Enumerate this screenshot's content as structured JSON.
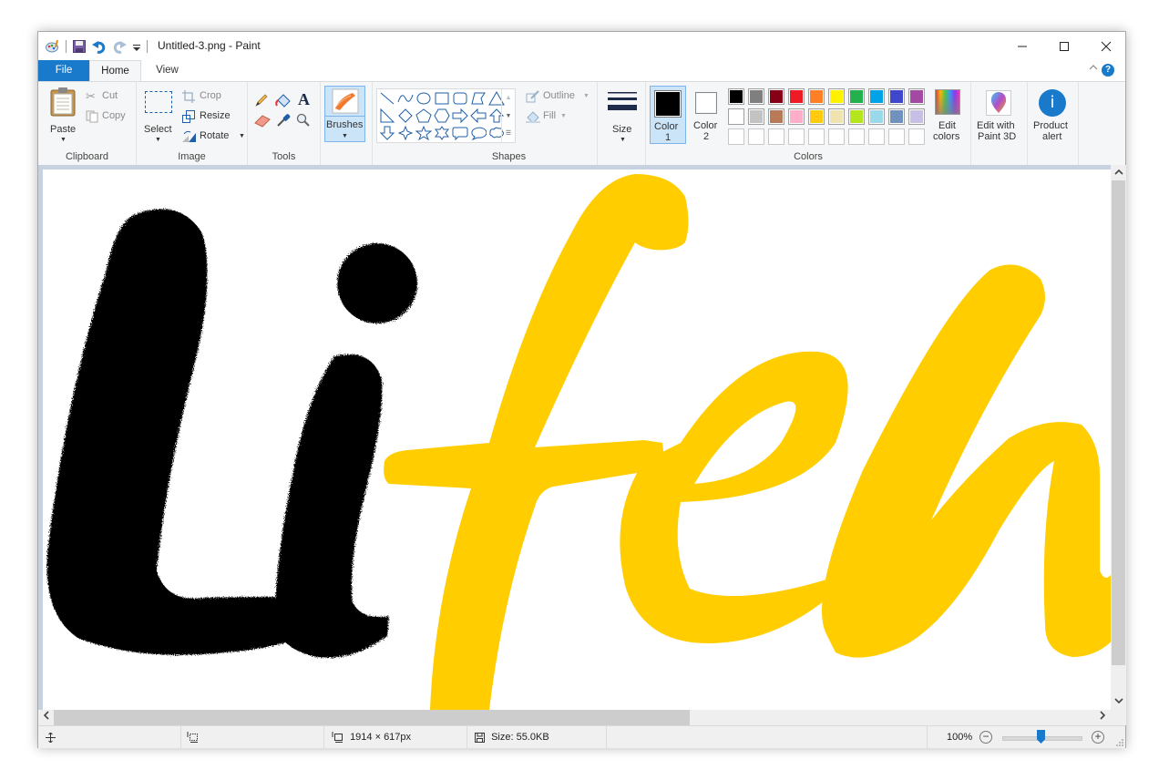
{
  "window": {
    "title": "Untitled-3.png - Paint",
    "controls": {
      "minimize": "—",
      "maximize": "☐",
      "close": "✕"
    }
  },
  "quick_access": {
    "icons": [
      "paint-app-icon",
      "save-icon",
      "undo-icon",
      "redo-icon",
      "customize-qat-icon"
    ]
  },
  "tabs": [
    {
      "label": "File",
      "active": false
    },
    {
      "label": "Home",
      "active": true
    },
    {
      "label": "View",
      "active": false
    }
  ],
  "ribbon": {
    "clipboard": {
      "group_label": "Clipboard",
      "paste": "Paste",
      "cut": "Cut",
      "copy": "Copy"
    },
    "image": {
      "group_label": "Image",
      "select": "Select",
      "crop": "Crop",
      "resize": "Resize",
      "rotate": "Rotate"
    },
    "tools": {
      "group_label": "Tools",
      "items": [
        "pencil",
        "fill",
        "text",
        "eraser",
        "color-picker",
        "magnifier"
      ]
    },
    "brushes": {
      "label": "Brushes"
    },
    "shapes": {
      "group_label": "Shapes",
      "outline": "Outline",
      "fill": "Fill",
      "items": [
        "line",
        "curve",
        "oval",
        "rectangle",
        "rounded-rectangle",
        "polygon",
        "triangle",
        "right-triangle",
        "diamond",
        "pentagon",
        "hexagon",
        "right-arrow",
        "left-arrow",
        "up-arrow",
        "down-arrow",
        "four-point-star",
        "five-point-star",
        "six-point-star",
        "rounded-callout",
        "oval-callout",
        "cloud-callout"
      ]
    },
    "size": {
      "label": "Size"
    },
    "colors": {
      "group_label": "Colors",
      "color1_label": "Color",
      "color1_num": "1",
      "color2_label": "Color",
      "color2_num": "2",
      "color1": "#000000",
      "color2": "#ffffff",
      "palette_row1": [
        "#000000",
        "#7f7f7f",
        "#880015",
        "#ed1c24",
        "#ff7f27",
        "#fff200",
        "#22b14c",
        "#00a2e8",
        "#3f48cc",
        "#a349a4"
      ],
      "palette_row2": [
        "#ffffff",
        "#c3c3c3",
        "#b97a57",
        "#ffaec9",
        "#ffc90e",
        "#efe4b0",
        "#b5e61d",
        "#99d9ea",
        "#7092be",
        "#c8bfe7"
      ],
      "palette_row3": [
        "",
        "",
        "",
        "",
        "",
        "",
        "",
        "",
        "",
        ""
      ],
      "edit_colors_line1": "Edit",
      "edit_colors_line2": "colors"
    },
    "paint3d": {
      "line1": "Edit with",
      "line2": "Paint 3D"
    },
    "product_alert": {
      "line1": "Product",
      "line2": "alert"
    }
  },
  "canvas": {
    "drawing_colors": {
      "black_brush": "#000000",
      "yellow_text": "#ffcd00"
    },
    "content_description": "Black brush-stroke 'Li' followed by yellow script letters 'feh'"
  },
  "statusbar": {
    "dimensions": "1914 × 617px",
    "size": "Size: 55.0KB",
    "zoom": "100%",
    "zoom_level_percent": 100
  }
}
